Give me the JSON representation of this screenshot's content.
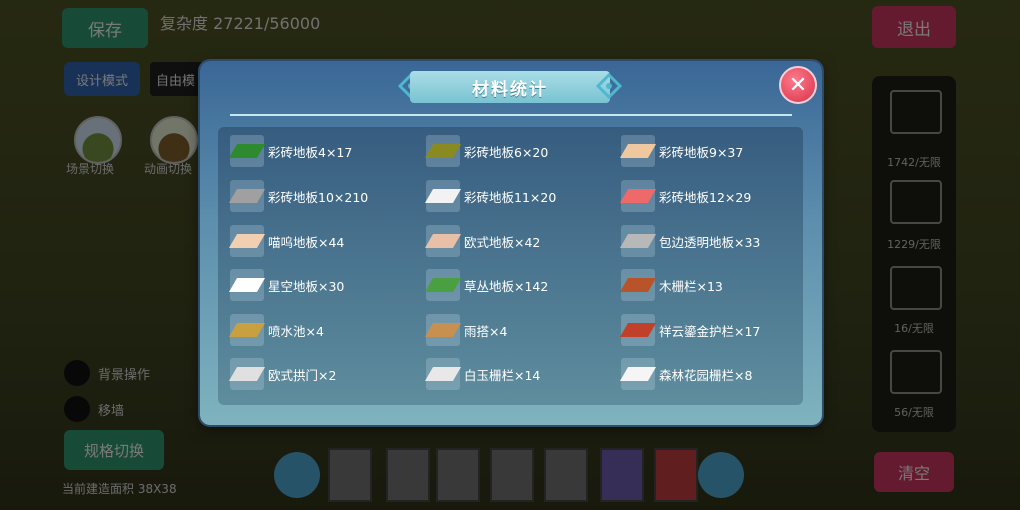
{
  "background": {
    "save_label": "保存",
    "complexity": "复杂度 27221/56000",
    "exit_label": "退出",
    "design_mode_label": "设计模式",
    "free_label": "自由模",
    "scene_switch_label": "场景切换",
    "animation_label": "动画切换",
    "bg_op1": "背景操作",
    "bg_op2": "移墙",
    "spec_switch_label": "规格切换",
    "area_label": "当前建造面积 38X38",
    "right_counts": [
      "1742/无限",
      "1229/无限",
      "16/无限",
      "56/无限"
    ],
    "clear_label": "清空"
  },
  "modal": {
    "title": "材料统计",
    "close_symbol": "✕",
    "items": [
      {
        "label": "彩砖地板4×17",
        "icon": "green-tile-icon",
        "color": "#2e8a2e"
      },
      {
        "label": "彩砖地板6×20",
        "icon": "olive-tile-icon",
        "color": "#8a8a22"
      },
      {
        "label": "彩砖地板9×37",
        "icon": "peach-tile-icon",
        "color": "#f0c8a0"
      },
      {
        "label": "彩砖地板10×210",
        "icon": "gray-tile-icon",
        "color": "#a0a0a0"
      },
      {
        "label": "彩砖地板11×20",
        "icon": "white-tile-icon",
        "color": "#f2f2f2"
      },
      {
        "label": "彩砖地板12×29",
        "icon": "red-tile-icon",
        "color": "#ee6a6a"
      },
      {
        "label": "喵呜地板×44",
        "icon": "cat-tile-icon",
        "color": "#f0d0b0"
      },
      {
        "label": "欧式地板×42",
        "icon": "euro-tile-icon",
        "color": "#e8c0a8"
      },
      {
        "label": "包边透明地板×33",
        "icon": "transparent-tile-icon",
        "color": "#b8b8b8"
      },
      {
        "label": "星空地板×30",
        "icon": "star-tile-icon",
        "color": "#ffffff"
      },
      {
        "label": "草丛地板×142",
        "icon": "grass-tile-icon",
        "color": "#4aa040"
      },
      {
        "label": "木栅栏×13",
        "icon": "wood-fence-icon",
        "color": "#b8542a"
      },
      {
        "label": "喷水池×4",
        "icon": "fountain-icon",
        "color": "#c8a040"
      },
      {
        "label": "雨搭×4",
        "icon": "awning-icon",
        "color": "#c89050"
      },
      {
        "label": "祥云鎏金护栏×17",
        "icon": "cloud-railing-icon",
        "color": "#c0402a"
      },
      {
        "label": "欧式拱门×2",
        "icon": "arch-door-icon",
        "color": "#e0e0e0"
      },
      {
        "label": "白玉栅栏×14",
        "icon": "jade-fence-icon",
        "color": "#e8e8e8"
      },
      {
        "label": "森林花园栅栏×8",
        "icon": "garden-fence-icon",
        "color": "#f5f5f5"
      }
    ]
  }
}
